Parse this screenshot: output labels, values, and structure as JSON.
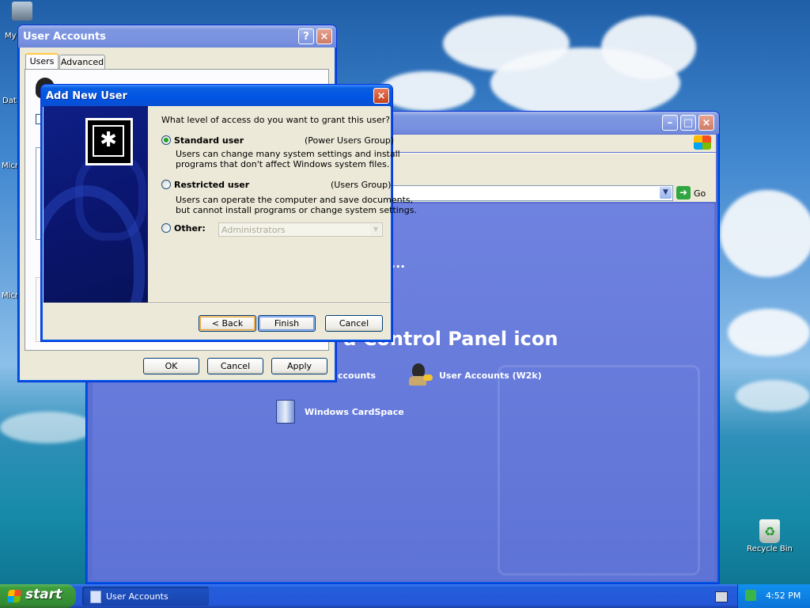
{
  "desktop": {
    "icons_left": [
      {
        "label": "My"
      },
      {
        "label": "Dat"
      },
      {
        "label": "Micro"
      },
      {
        "label": "Micro"
      }
    ],
    "recycle_bin": {
      "label": "Recycle Bin",
      "icon": "recycle-bin-icon"
    }
  },
  "control_panel": {
    "go_label": "Go",
    "heading_partial": "r a Control Panel icon",
    "dots": "...",
    "items": [
      {
        "label": "ccounts",
        "icon": "user-accounts-icon"
      },
      {
        "label": "User Accounts (W2k)",
        "icon": "user-accounts-w2k-icon"
      },
      {
        "label": "Windows CardSpace",
        "icon": "cardspace-icon"
      }
    ]
  },
  "user_accounts": {
    "title": "User Accounts",
    "tabs": [
      {
        "label": "Users"
      },
      {
        "label": "Advanced"
      }
    ],
    "buttons": {
      "ok": "OK",
      "cancel": "Cancel",
      "apply": "Apply"
    }
  },
  "add_user": {
    "title": "Add New User",
    "question": "What level of access do you want to grant this user?",
    "options": [
      {
        "label": "Standard user",
        "group": "(Power Users Group)",
        "desc1": "Users can change many system settings and install",
        "desc2": "programs that don't affect Windows system files.",
        "selected": true
      },
      {
        "label": "Restricted user",
        "group": "(Users Group)",
        "desc1": "Users can operate the computer and save documents,",
        "desc2": "but cannot install programs or change system settings.",
        "selected": false
      },
      {
        "label": "Other:",
        "selected": false
      }
    ],
    "other_select_value": "Administrators",
    "buttons": {
      "back": "< Back",
      "finish": "Finish",
      "cancel": "Cancel"
    }
  },
  "taskbar": {
    "start_label": "start",
    "task_label": "User Accounts",
    "clock": "4:52 PM"
  }
}
